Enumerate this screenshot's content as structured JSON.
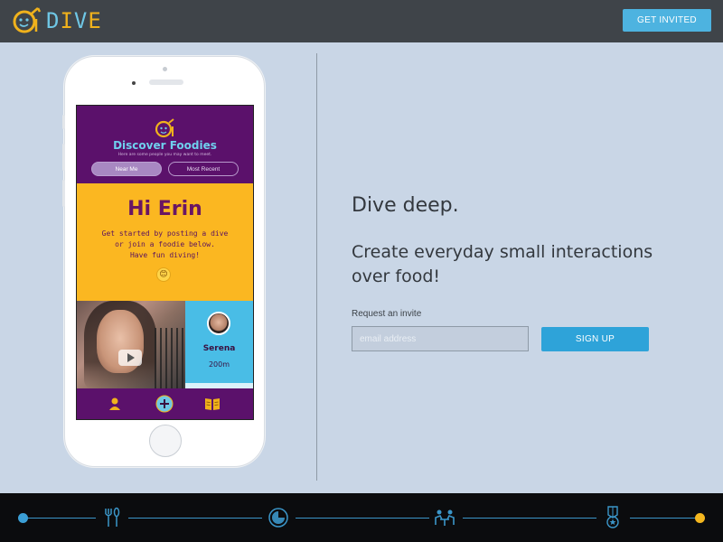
{
  "brand": {
    "logo_text": "DIVE",
    "accent_yellow": "#f0b21c",
    "accent_blue": "#6fc7e5"
  },
  "header": {
    "cta_label": "GET INVITED"
  },
  "phone_app": {
    "title": "Discover Foodies",
    "subtitle": "Here are some people you may want to meet.",
    "filters": [
      "Near Me",
      "Most Recent"
    ],
    "greeting": {
      "title": "Hi Erin",
      "body": "Get started by posting a dive\nor join a foodie below.\nHave fun diving!",
      "emoji": "😊"
    },
    "profile_card": {
      "name": "Serena",
      "distance": "200m"
    },
    "nav_icons": [
      "person-icon",
      "add-icon",
      "menu-book-icon"
    ]
  },
  "hero": {
    "headline": "Dive deep.",
    "subheadline": "Create everyday small interactions over food!",
    "request_label": "Request an invite",
    "email_placeholder": "email address",
    "signup_label": "SIGN UP"
  },
  "timeline": {
    "icons": [
      "fork-spoon-icon",
      "clock-icon",
      "dining-people-icon",
      "medal-icon"
    ],
    "colors": {
      "line": "#3b96c9",
      "start_dot": "#3b9fd6",
      "end_dot": "#f4b71f"
    }
  }
}
